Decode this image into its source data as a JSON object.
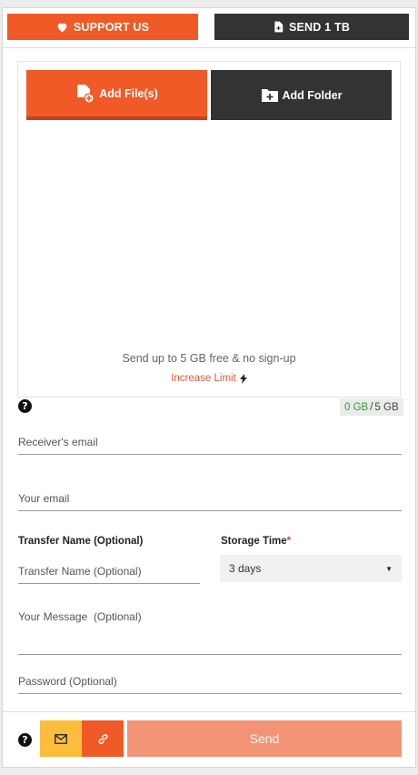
{
  "top_buttons": {
    "support_label": "SUPPORT US",
    "send_label": "SEND 1 TB"
  },
  "upload": {
    "add_files_label": "Add File(s)",
    "add_folder_label": "Add Folder",
    "info_text": "Send up to 5 GB free & no sign-up",
    "increase_label": "Increase Limit"
  },
  "quota": {
    "used": "0 GB",
    "separator": "/",
    "total": "5 GB"
  },
  "form": {
    "receiver_placeholder": "Receiver's email",
    "your_email_placeholder": "Your email",
    "transfer_name_label": "Transfer Name (Optional)",
    "transfer_name_placeholder": "Transfer Name (Optional)",
    "storage_label": "Storage Time",
    "storage_required_mark": "*",
    "storage_value": "3 days",
    "message_placeholder": "Your Message  (Optional)",
    "password_placeholder": "Password (Optional)"
  },
  "footer": {
    "help_glyph": "?",
    "send_label": "Send"
  },
  "colors": {
    "accent_orange": "#f05a26",
    "dark": "#333333",
    "email_yellow": "#fbbd3b",
    "send_disabled": "#f39376",
    "quota_used_green": "#3a9a3a"
  },
  "icons": {
    "support": "heart-icon",
    "send1tb": "file-plus-icon",
    "add_files": "file-add-icon",
    "add_folder": "folder-plus-icon",
    "increase": "lightning-icon",
    "email": "envelope-icon",
    "link": "link-icon",
    "help": "question-circle-icon",
    "select": "caret-down-icon"
  }
}
